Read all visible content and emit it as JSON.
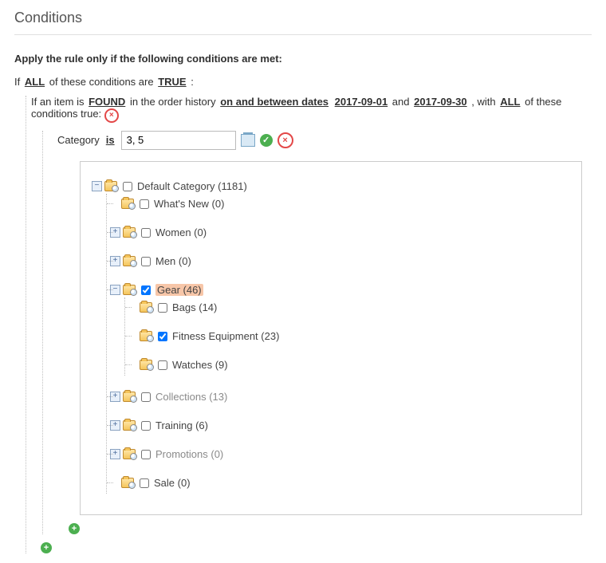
{
  "section_title": "Conditions",
  "lead_text": "Apply the rule only if the following conditions are met:",
  "root_rule": {
    "prefix": "If",
    "aggregator": "ALL",
    "middle": "of these conditions are",
    "value": "TRUE",
    "suffix": ":"
  },
  "history_rule": {
    "prefix": "If an item is",
    "found": "FOUND",
    "mid1": "in the order history",
    "range_label": "on and between dates",
    "from": "2017-09-01",
    "and": "and",
    "to": "2017-09-30",
    "mid2": ", with",
    "agg": "ALL",
    "suffix": "of these conditions true:"
  },
  "category_cond": {
    "attr": "Category",
    "op": "is",
    "value": "3, 5"
  },
  "tree": {
    "root": {
      "label": "Default Category (1181)",
      "checked": false,
      "expanded": true
    },
    "whats_new": {
      "label": "What's New (0)",
      "checked": false
    },
    "women": {
      "label": "Women (0)",
      "checked": false,
      "expanded": false
    },
    "men": {
      "label": "Men (0)",
      "checked": false,
      "expanded": false
    },
    "gear": {
      "label": "Gear (46)",
      "checked": true,
      "expanded": true
    },
    "bags": {
      "label": "Bags (14)",
      "checked": false
    },
    "fitness": {
      "label": "Fitness Equipment (23)",
      "checked": true
    },
    "watches": {
      "label": "Watches (9)",
      "checked": false
    },
    "collections": {
      "label": "Collections (13)",
      "checked": false,
      "expanded": false
    },
    "training": {
      "label": "Training (6)",
      "checked": false,
      "expanded": false
    },
    "promotions": {
      "label": "Promotions (0)",
      "checked": false,
      "expanded": false
    },
    "sale": {
      "label": "Sale (0)",
      "checked": false
    }
  }
}
